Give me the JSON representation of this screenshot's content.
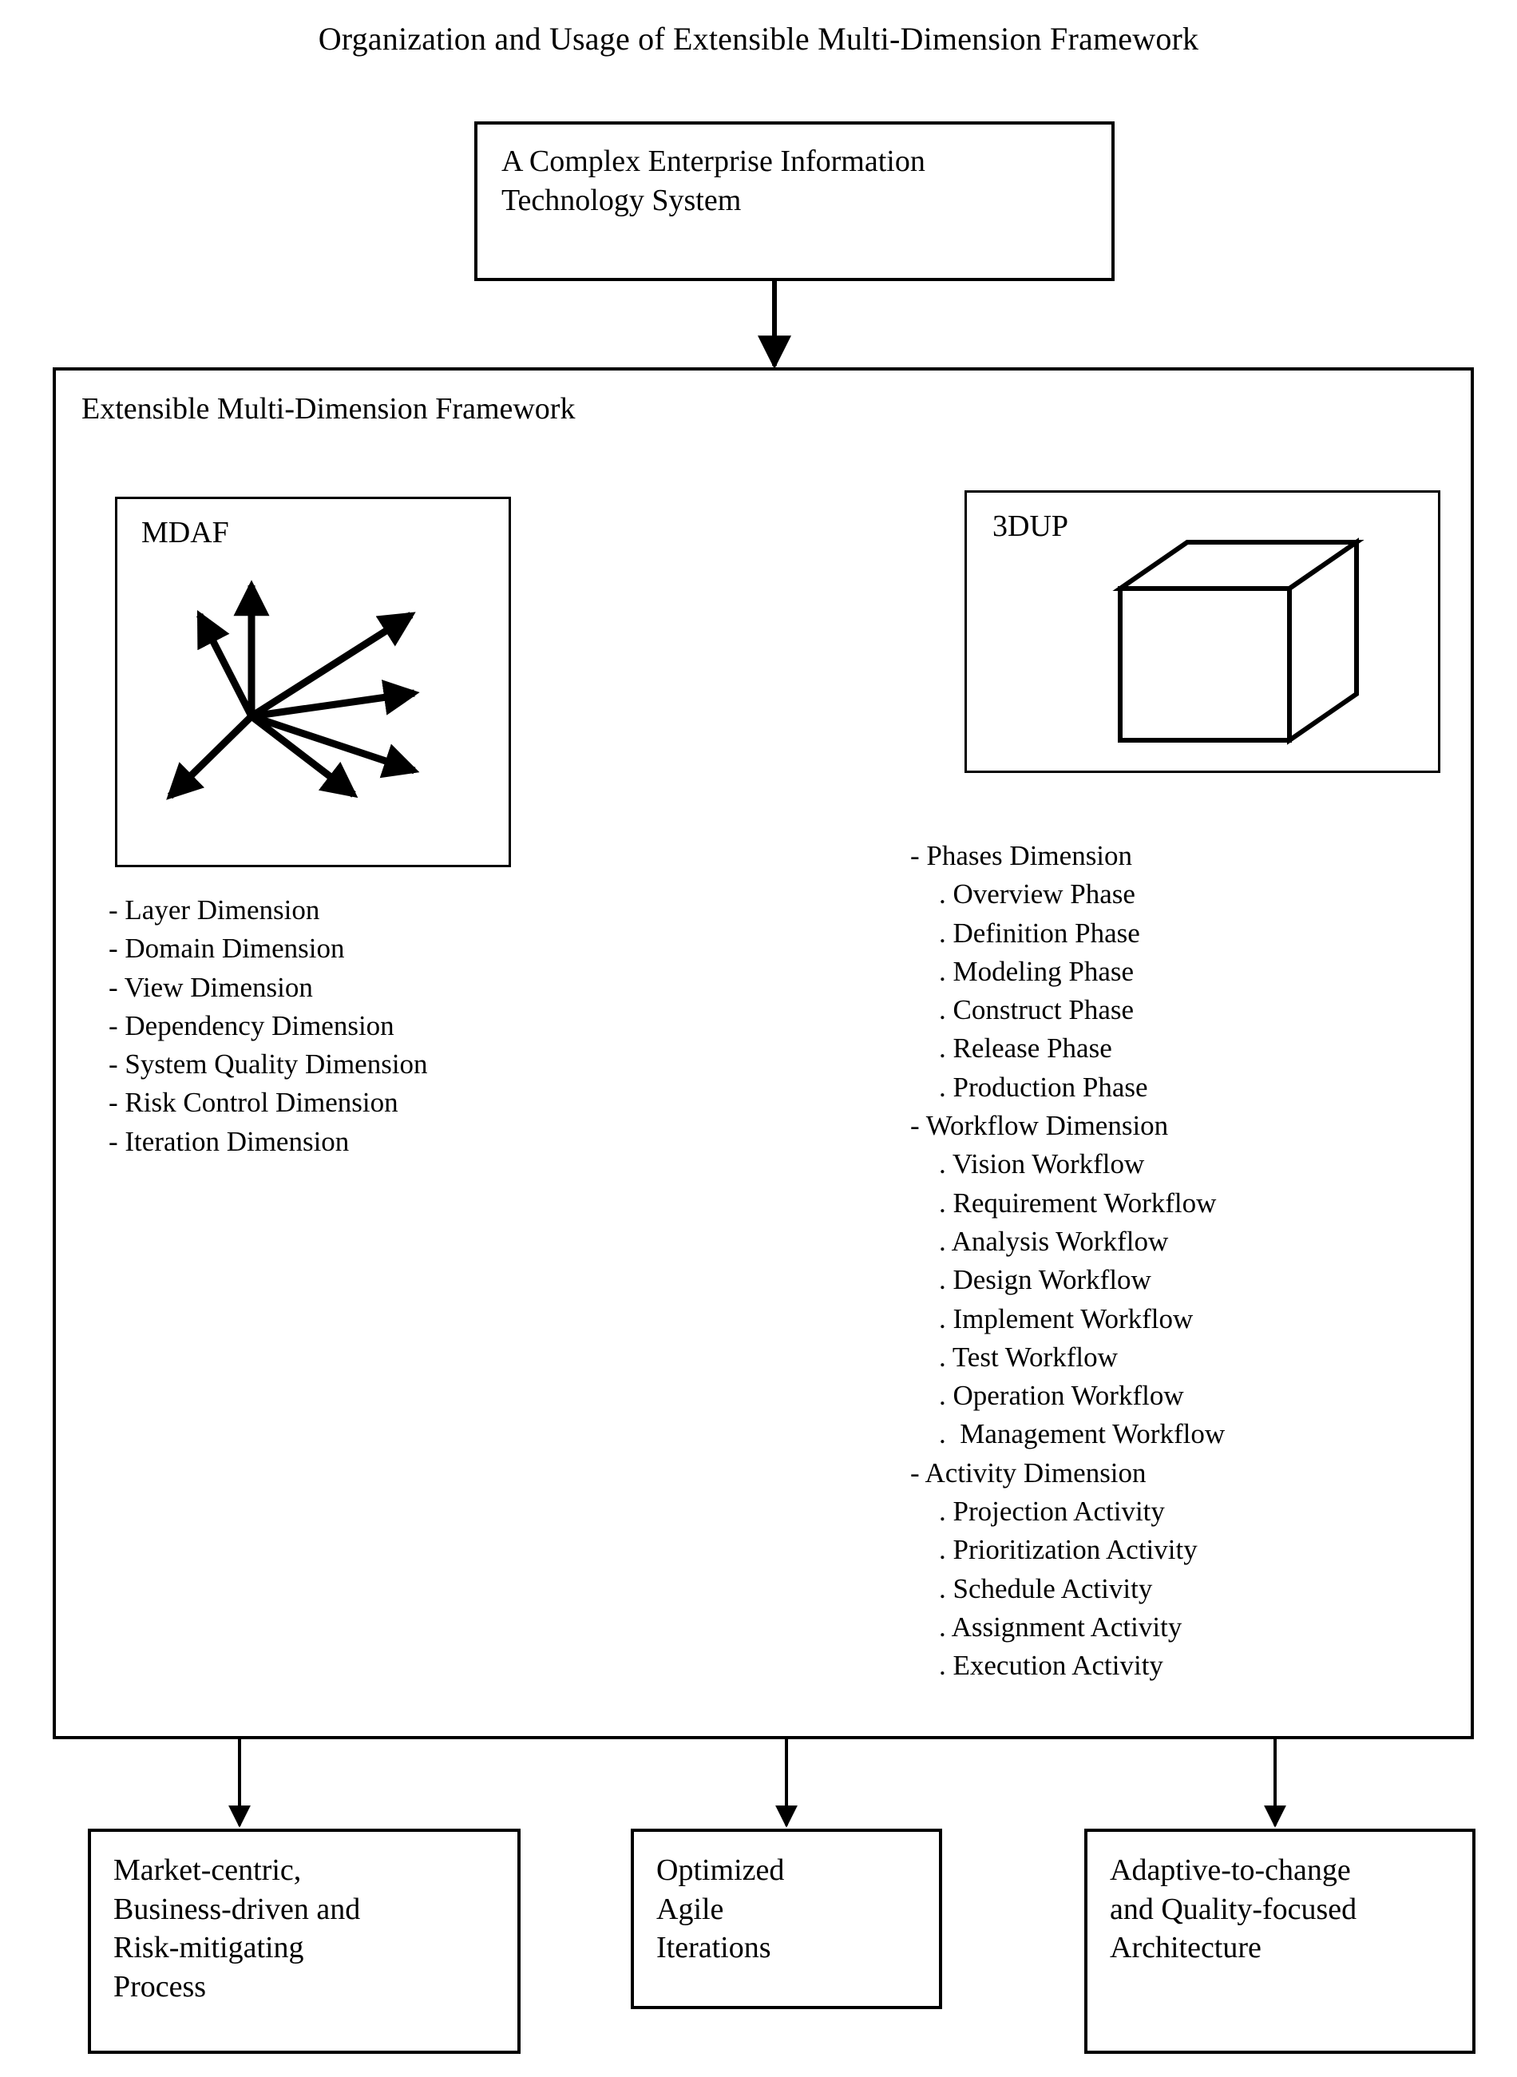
{
  "title": "Organization and Usage of Extensible Multi-Dimension Framework",
  "top_box": {
    "label": "A Complex Enterprise Information\nTechnology System"
  },
  "framework": {
    "label": "Extensible Multi-Dimension Framework",
    "mdaf": {
      "label": "MDAF",
      "diagram_icon": "multi-axis-arrow-star",
      "arrow_count": 7
    },
    "tdup": {
      "label": "3DUP",
      "diagram_icon": "3d-cube"
    },
    "left_dimensions": [
      "- Layer Dimension",
      "- Domain Dimension",
      "- View Dimension",
      "- Dependency Dimension",
      "- System Quality Dimension",
      "- Risk Control Dimension",
      "- Iteration Dimension"
    ],
    "right_dimensions": [
      {
        "group": "- Phases Dimension",
        "items": [
          ". Overview Phase",
          ". Definition Phase",
          ". Modeling Phase",
          ". Construct Phase",
          ". Release Phase",
          ". Production Phase"
        ]
      },
      {
        "group": "- Workflow Dimension",
        "items": [
          ". Vision Workflow",
          ". Requirement Workflow",
          ". Analysis Workflow",
          ". Design Workflow",
          ". Implement Workflow",
          ". Test Workflow",
          ". Operation Workflow",
          ".  Management Workflow"
        ]
      },
      {
        "group": "- Activity Dimension",
        "items": [
          ". Projection Activity",
          ". Prioritization Activity",
          ". Schedule Activity",
          ". Assignment Activity",
          ". Execution Activity"
        ]
      }
    ]
  },
  "outcomes": [
    {
      "label": "Market-centric,\nBusiness-driven and\nRisk-mitigating\nProcess"
    },
    {
      "label": "Optimized\nAgile\nIterations"
    },
    {
      "label": "Adaptive-to-change\nand Quality-focused\nArchitecture"
    }
  ],
  "colors": {
    "stroke": "#000000",
    "background": "#ffffff",
    "text": "#000000"
  }
}
